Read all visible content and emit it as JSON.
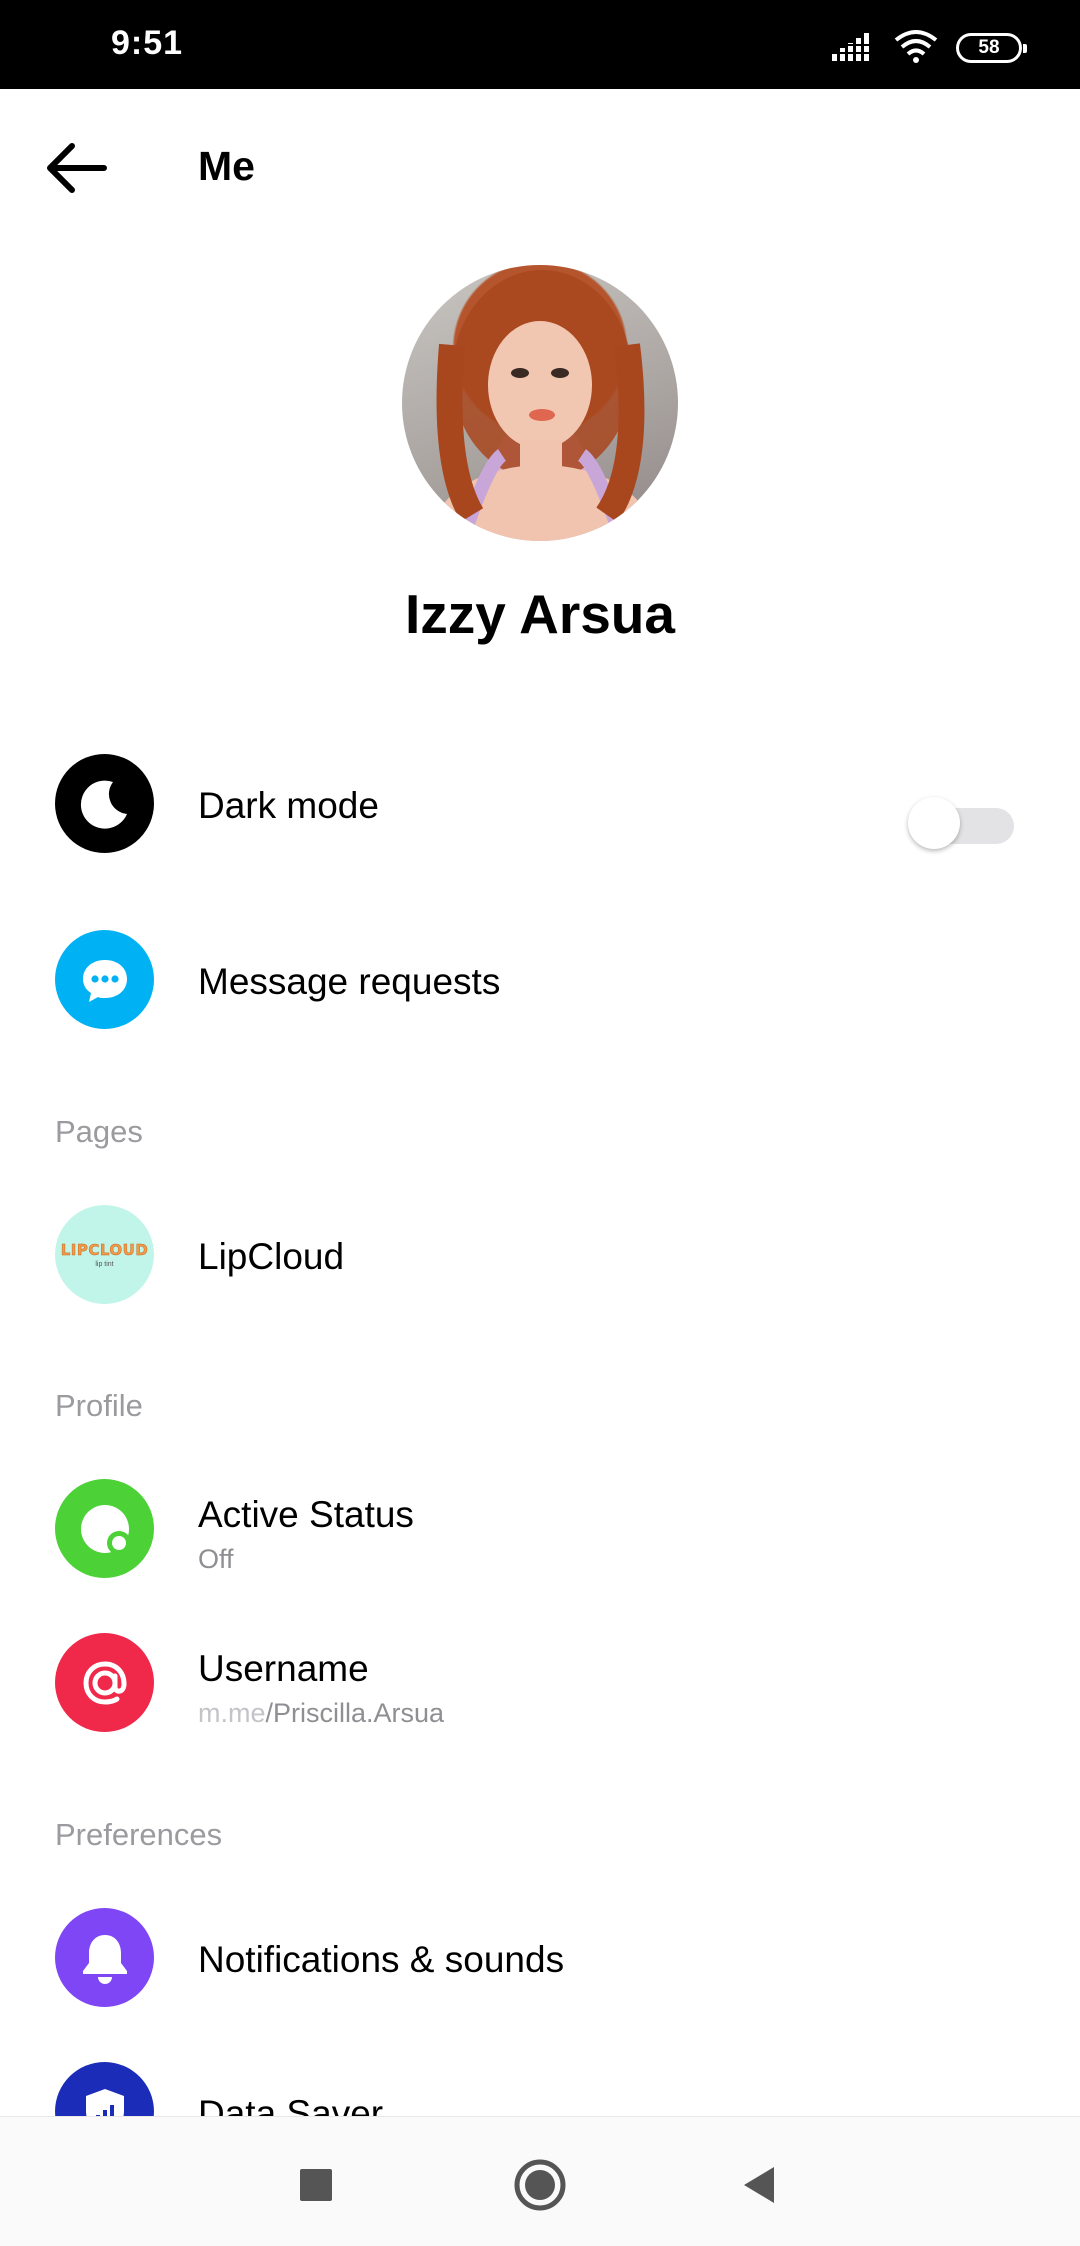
{
  "status_bar": {
    "time": "9:51",
    "battery": "58",
    "icons": [
      "signal-icon",
      "wifi-icon",
      "battery-icon"
    ]
  },
  "header": {
    "title": "Me",
    "back_icon": "arrow-left-icon"
  },
  "profile": {
    "name": "Izzy Arsua"
  },
  "rows": {
    "dark_mode": {
      "label": "Dark mode",
      "icon": "moon-icon",
      "color": "#000000",
      "toggle_on": false
    },
    "message_requests": {
      "label": "Message requests",
      "icon": "chat-bubble-icon",
      "color": "#00b2f3"
    }
  },
  "sections": {
    "pages": "Pages",
    "profile": "Profile",
    "preferences": "Preferences"
  },
  "pages": {
    "lipcloud": {
      "label": "LipCloud",
      "logo_text": "LIPCLOUD",
      "logo_subtext": "lip tint",
      "color": "#c2f5e9"
    }
  },
  "profile_items": {
    "active_status": {
      "label": "Active Status",
      "value": "Off",
      "icon": "active-status-icon",
      "color": "#4cd137"
    },
    "username": {
      "label": "Username",
      "prefix": "m.me",
      "path": "/Priscilla.Arsua",
      "icon": "at-sign-icon",
      "color": "#f0284a"
    }
  },
  "preferences_items": {
    "notifications": {
      "label": "Notifications & sounds",
      "icon": "bell-icon",
      "color": "#7f46f5"
    },
    "data_saver": {
      "label": "Data Saver",
      "icon": "shield-icon",
      "color": "#1b2db8"
    }
  },
  "nav_bar": {
    "icons": [
      "recent-apps-icon",
      "home-icon",
      "back-icon"
    ]
  }
}
